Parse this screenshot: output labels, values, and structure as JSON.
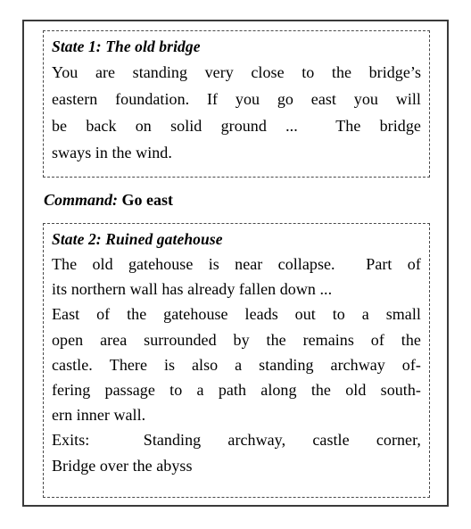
{
  "figure": {
    "state_1": {
      "title": "State 1: The old bridge",
      "lines": [
        [
          "You",
          "are",
          "standing",
          "very",
          "close",
          "to",
          "the",
          "bridge’s"
        ],
        [
          "eastern",
          "foundation.",
          "If",
          "you",
          "go",
          "east",
          "you",
          "will"
        ],
        [
          "be",
          "back",
          "on",
          "solid",
          "ground",
          "...",
          "",
          "The",
          "bridge"
        ],
        [
          "sways in the wind."
        ]
      ],
      "text": "You are standing very close to the bridge’s eastern foundation. If you go east you will be back on solid ground ... The bridge sways in the wind."
    },
    "command": {
      "label": "Command:",
      "value": "Go east"
    },
    "state_2": {
      "title": "State 2: Ruined gatehouse",
      "lines": [
        [
          "The",
          "old",
          "gatehouse",
          "is",
          "near",
          "collapse.",
          "",
          "Part",
          "of"
        ],
        [
          "its northern wall has already fallen down ..."
        ],
        [
          "East",
          "of",
          "the",
          "gatehouse",
          "leads",
          "out",
          "to",
          "a",
          "small"
        ],
        [
          "open",
          "area",
          "surrounded",
          "by",
          "the",
          "remains",
          "of",
          "the"
        ],
        [
          "castle.",
          "There",
          "is",
          "also",
          "a",
          "standing",
          "archway",
          "of-"
        ],
        [
          "fering",
          "passage",
          "to",
          "a",
          "path",
          "along",
          "the",
          "old",
          "south-"
        ],
        [
          "ern inner wall."
        ],
        [
          "Exits:",
          "",
          "Standing",
          "archway,",
          "castle",
          "corner,"
        ],
        [
          "Bridge over the abyss"
        ]
      ],
      "text": "The old gatehouse is near collapse. Part of its northern wall has already fallen down ... East of the gatehouse leads out to a small open area surrounded by the remains of the castle. There is also a standing archway offering passage to a path along the old southern inner wall.",
      "exits_label": "Exits:",
      "exits": "Standing archway, castle corner, Bridge over the abyss"
    }
  },
  "style": {
    "frame_color": "#3a3a3a",
    "dash_color": "#4a4a4a",
    "text_color": "#000000",
    "background": "#ffffff"
  }
}
